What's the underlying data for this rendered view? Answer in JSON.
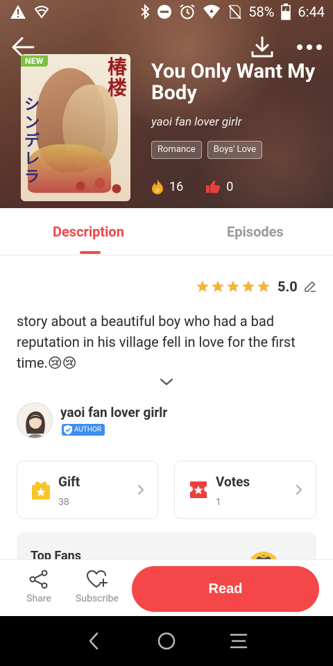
{
  "status_bar": {
    "battery": "58%",
    "time": "6:44"
  },
  "book": {
    "badge": "NEW",
    "title": "You Only Want My Body",
    "author_line": "yaoi fan lover girlr",
    "tags": [
      "Romance",
      "Boys' Love"
    ],
    "likes": "16",
    "dislikes": "0"
  },
  "tabs": {
    "description": "Description",
    "episodes": "Episodes"
  },
  "rating": {
    "value": "5.0",
    "stars": 5
  },
  "description_text": "story about a beautiful boy who had a bad reputation in his village fell in love for the first time.😢😢",
  "author": {
    "name": "yaoi fan lover girlr",
    "badge": "AUTHOR"
  },
  "cards": {
    "gift": {
      "label": "Gift",
      "count": "38"
    },
    "votes": {
      "label": "Votes",
      "count": "1"
    }
  },
  "top_fans": {
    "label": "Top Fans"
  },
  "actions": {
    "share": "Share",
    "subscribe": "Subscribe",
    "read": "Read"
  },
  "colors": {
    "accent": "#f54747",
    "new_badge": "#7cc142",
    "star": "#f5b23d",
    "author_badge": "#3d8ef0"
  }
}
